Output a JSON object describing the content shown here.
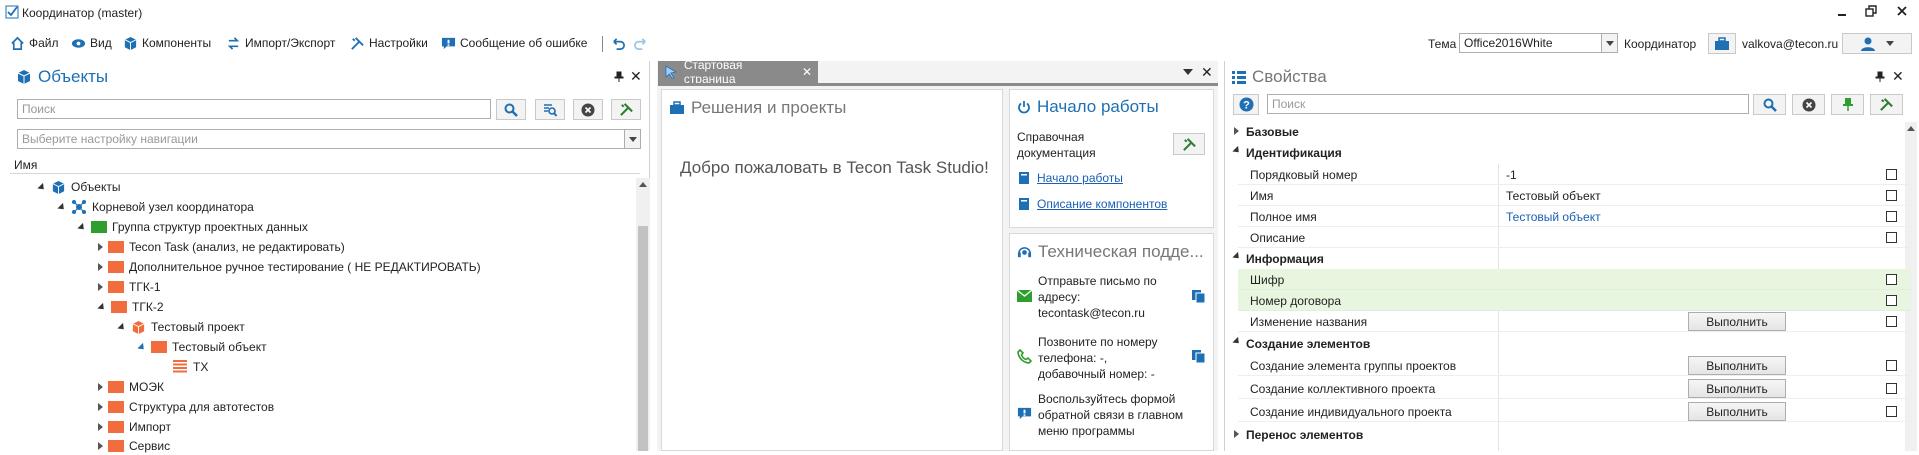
{
  "window": {
    "title": "Координатор (master)"
  },
  "menu": {
    "file": "Файл",
    "view": "Вид",
    "components": "Компоненты",
    "import_export": "Импорт/Экспорт",
    "settings": "Настройки",
    "report_bug": "Сообщение об ошибке"
  },
  "header": {
    "theme_label": "Тема",
    "theme_value": "Office2016White",
    "coordinator_label": "Координатор",
    "user": "valkova@tecon.ru"
  },
  "objects_panel": {
    "title": "Объекты",
    "search_placeholder": "Поиск",
    "nav_placeholder": "Выберите настройку навигации",
    "column_name": "Имя",
    "tree": [
      "Объекты",
      "Корневой узел координатора",
      "Группа структур проектных данных",
      "Tecon Task (анализ, не редактировать)",
      "Дополнительное ручное тестирование ( НЕ РЕДАКТИРОВАТЬ)",
      "ТГК-1",
      "ТГК-2",
      "Тестовый проект",
      "Тестовый объект",
      "ТХ",
      "МОЭК",
      "Структура для автотестов",
      "Импорт",
      "Сервис"
    ]
  },
  "start_page": {
    "tab": "Стартовая страница",
    "solutions_title": "Решения и проекты",
    "welcome": "Добро пожаловать в Tecon Task Studio!",
    "getting_started_title": "Начало работы",
    "reference_docs": "Справочная документация",
    "link_start": "Начало работы",
    "link_components": "Описание компонентов",
    "support_title": "Техническая подде...",
    "support_email": "Отправьте письмо по адресу: tecontask@tecon.ru",
    "support_phone": "Позвоните по номеру телефона: -, добавочный номер: -",
    "support_feedback": "Воспользуйтесь формой обратной связи в главном меню программы"
  },
  "properties_panel": {
    "title": "Свойства",
    "search_placeholder": "Поиск",
    "run_label": "Выполнить",
    "groups": {
      "basic": "Базовые",
      "identification": "Идентификация",
      "info": "Информация",
      "create": "Создание элементов",
      "move": "Перенос элементов"
    },
    "rows": {
      "order_name": "Порядковый номер",
      "order_value": "-1",
      "name_name": "Имя",
      "name_value": "Тестовый объект",
      "fullname_name": "Полное имя",
      "fullname_value": "Тестовый объект",
      "desc_name": "Описание",
      "cipher_name": "Шифр",
      "contract_name": "Номер договора",
      "rename_name": "Изменение названия",
      "create_group_name": "Создание элемента группы проектов",
      "create_collective_name": "Создание коллективного проекта",
      "create_individual_name": "Создание индивидуального проекта"
    }
  },
  "colors": {
    "accent": "#1e6fb3",
    "folder": "#f26d3d",
    "highlight": "#e8f6e0"
  }
}
